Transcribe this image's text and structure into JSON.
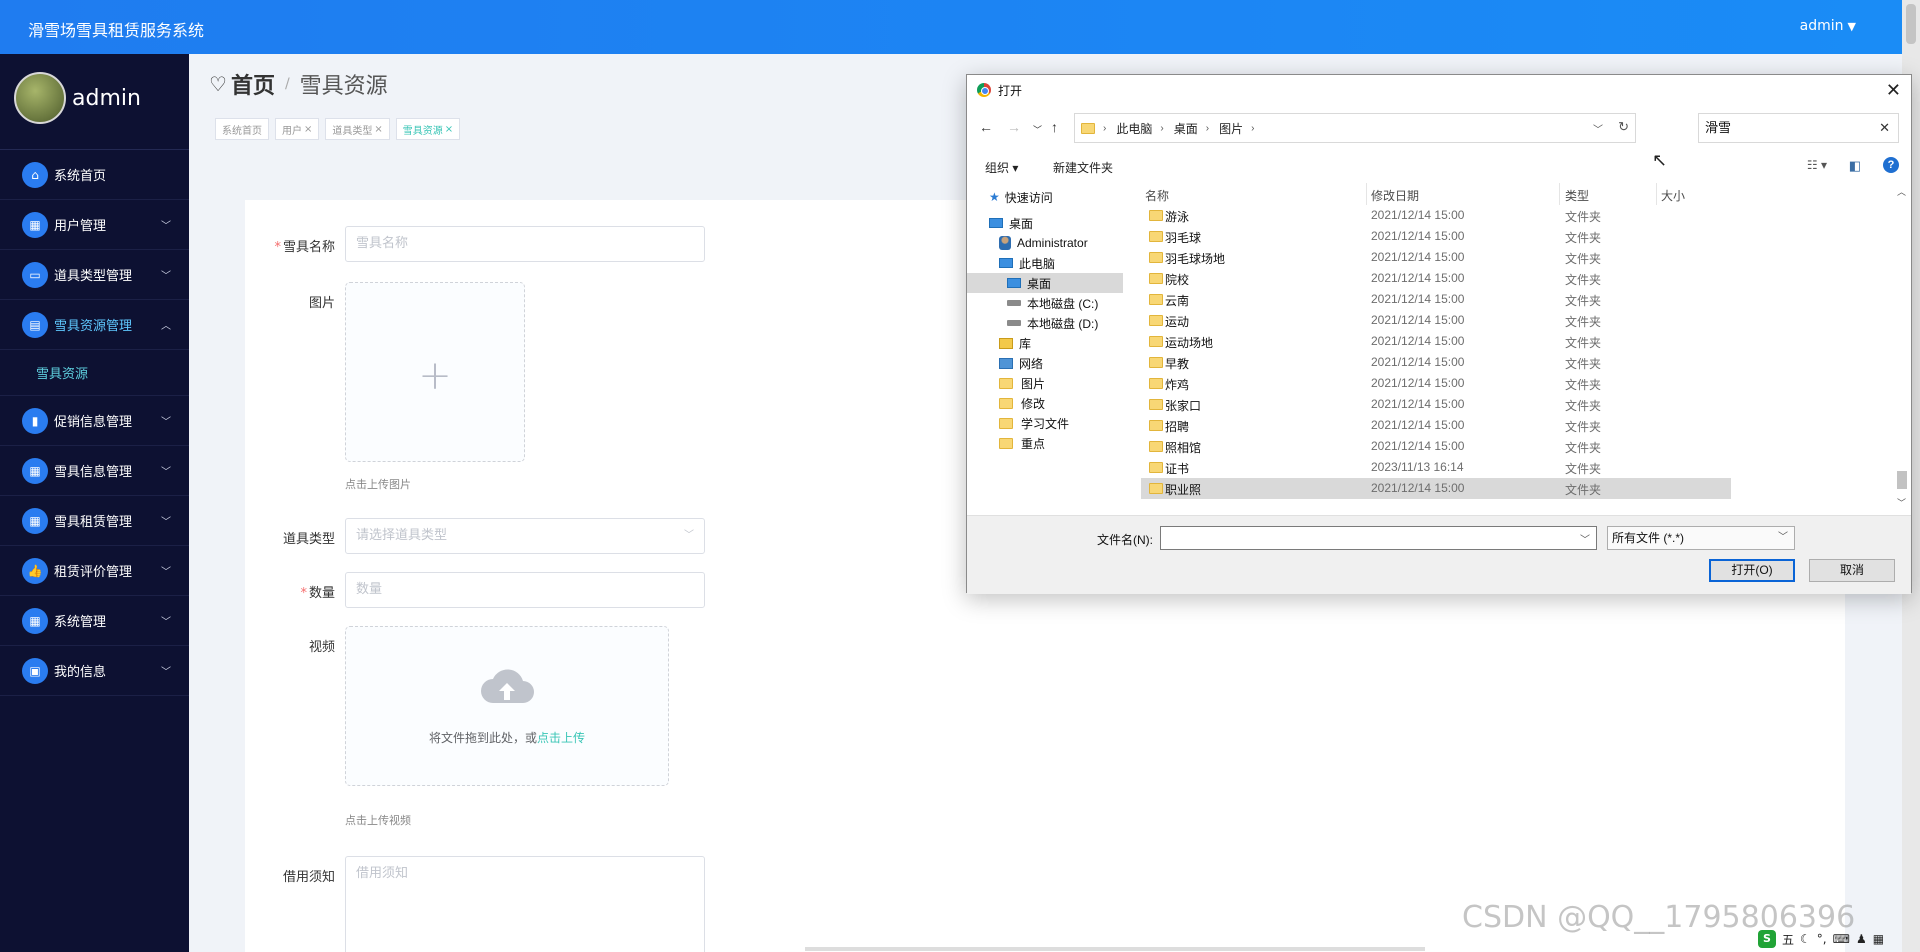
{
  "header": {
    "app_title": "滑雪场雪具租赁服务系统",
    "user": "admin"
  },
  "sidebar": {
    "username": "admin",
    "items": [
      {
        "label": "系统首页",
        "icon": "home-icon"
      },
      {
        "label": "用户管理",
        "icon": "grid-icon"
      },
      {
        "label": "道具类型管理",
        "icon": "monitor-icon"
      },
      {
        "label": "雪具资源管理",
        "icon": "briefcase-icon"
      },
      {
        "label": "促销信息管理",
        "icon": "bar-chart-icon"
      },
      {
        "label": "雪具信息管理",
        "icon": "grid-icon"
      },
      {
        "label": "雪具租赁管理",
        "icon": "grid-icon"
      },
      {
        "label": "租赁评价管理",
        "icon": "thumb-up-icon"
      },
      {
        "label": "系统管理",
        "icon": "grid-icon"
      },
      {
        "label": "我的信息",
        "icon": "card-icon"
      }
    ],
    "sub_item": "雪具资源"
  },
  "breadcrumb": {
    "home": "首页",
    "current": "雪具资源"
  },
  "tags": [
    "系统首页",
    "用户",
    "道具类型",
    "雪具资源"
  ],
  "form": {
    "name_label": "雪具名称",
    "name_placeholder": "雪具名称",
    "image_label": "图片",
    "image_hint": "点击上传图片",
    "type_label": "道具类型",
    "type_placeholder": "请选择道具类型",
    "qty_label": "数量",
    "qty_placeholder": "数量",
    "video_label": "视频",
    "video_drop_text": "将文件拖到此处，或",
    "video_drop_link": "点击上传",
    "video_hint": "点击上传视频",
    "notice_label": "借用须知",
    "notice_placeholder": "借用须知"
  },
  "dialog": {
    "title": "打开",
    "path": [
      "此电脑",
      "桌面",
      "图片"
    ],
    "search_value": "滑雪",
    "toolbar": {
      "organize": "组织",
      "new_folder": "新建文件夹"
    },
    "tree": [
      "快速访问",
      "桌面",
      "Administrator",
      "此电脑",
      "桌面",
      "本地磁盘 (C:)",
      "本地磁盘 (D:)",
      "库",
      "网络",
      "图片",
      "修改",
      "学习文件",
      "重点"
    ],
    "columns": [
      "名称",
      "修改日期",
      "类型",
      "大小"
    ],
    "rows": [
      {
        "name": "游泳",
        "date": "2021/12/14 15:00",
        "type": "文件夹"
      },
      {
        "name": "羽毛球",
        "date": "2021/12/14 15:00",
        "type": "文件夹"
      },
      {
        "name": "羽毛球场地",
        "date": "2021/12/14 15:00",
        "type": "文件夹"
      },
      {
        "name": "院校",
        "date": "2021/12/14 15:00",
        "type": "文件夹"
      },
      {
        "name": "云南",
        "date": "2021/12/14 15:00",
        "type": "文件夹"
      },
      {
        "name": "运动",
        "date": "2021/12/14 15:00",
        "type": "文件夹"
      },
      {
        "name": "运动场地",
        "date": "2021/12/14 15:00",
        "type": "文件夹"
      },
      {
        "name": "早教",
        "date": "2021/12/14 15:00",
        "type": "文件夹"
      },
      {
        "name": "炸鸡",
        "date": "2021/12/14 15:00",
        "type": "文件夹"
      },
      {
        "name": "张家口",
        "date": "2021/12/14 15:00",
        "type": "文件夹"
      },
      {
        "name": "招聘",
        "date": "2021/12/14 15:00",
        "type": "文件夹"
      },
      {
        "name": "照相馆",
        "date": "2021/12/14 15:00",
        "type": "文件夹"
      },
      {
        "name": "证书",
        "date": "2023/11/13 16:14",
        "type": "文件夹"
      },
      {
        "name": "职业照",
        "date": "2021/12/14 15:00",
        "type": "文件夹"
      }
    ],
    "filename_label": "文件名(N):",
    "filename_value": "",
    "filetype": "所有文件 (*.*)",
    "open_button": "打开(O)",
    "cancel_button": "取消"
  },
  "watermark": "CSDN @QQ__1795806396",
  "tray": {
    "ime": "五"
  }
}
